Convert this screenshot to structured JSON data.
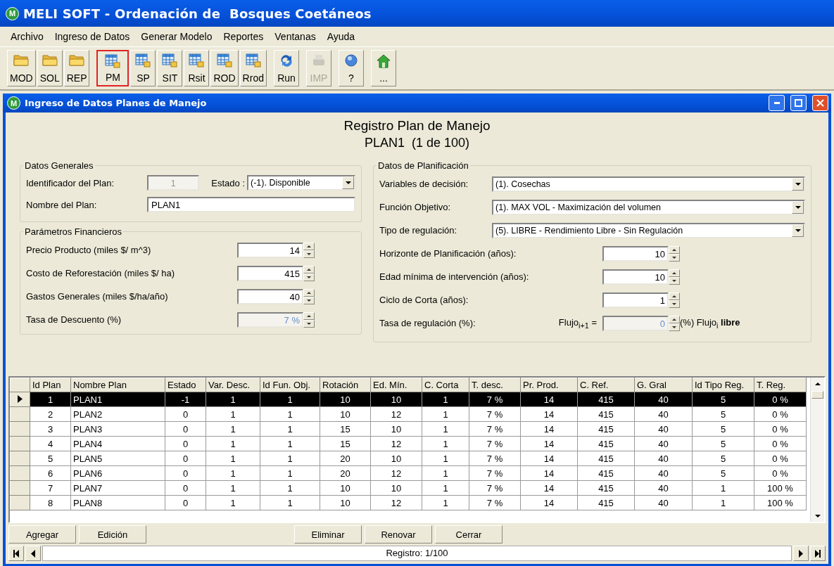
{
  "app": {
    "logo": "M",
    "title": "MELI SOFT - Ordenación de  Bosques Coetáneos"
  },
  "menu": [
    "Archivo",
    "Ingreso de Datos",
    "Generar Modelo",
    "Reportes",
    "Ventanas",
    "Ayuda"
  ],
  "toolbar": [
    [
      {
        "label": "MOD",
        "kind": "folder",
        "selected": false,
        "disabled": false
      },
      {
        "label": "SOL",
        "kind": "folder",
        "selected": false,
        "disabled": false
      },
      {
        "label": "REP",
        "kind": "folder",
        "selected": false,
        "disabled": false
      }
    ],
    [
      {
        "label": "PM",
        "kind": "table",
        "selected": true,
        "disabled": false
      },
      {
        "label": "SP",
        "kind": "table",
        "selected": false,
        "disabled": false
      },
      {
        "label": "SIT",
        "kind": "table",
        "selected": false,
        "disabled": false
      },
      {
        "label": "Rsit",
        "kind": "table",
        "selected": false,
        "disabled": false
      },
      {
        "label": "ROD",
        "kind": "table",
        "selected": false,
        "disabled": false
      },
      {
        "label": "Rrod",
        "kind": "table",
        "selected": false,
        "disabled": false
      }
    ],
    [
      {
        "label": "Run",
        "kind": "run",
        "selected": false,
        "disabled": false
      }
    ],
    [
      {
        "label": "IMP",
        "kind": "print",
        "selected": false,
        "disabled": true
      }
    ],
    [
      {
        "label": "?",
        "kind": "help",
        "selected": false,
        "disabled": false
      }
    ],
    [
      {
        "label": "...",
        "kind": "home",
        "selected": false,
        "disabled": false
      }
    ]
  ],
  "window": {
    "logo": "M",
    "title": "Ingreso de Datos Planes de Manejo",
    "heading": "Registro Plan de Manejo",
    "subheading": "PLAN1  (1 de 100)",
    "general": {
      "title": "Datos Generales",
      "id_label": "Identificador del Plan:",
      "id_value": "1",
      "estado_label": "Estado :",
      "estado_value": "(-1). Disponible",
      "name_label": "Nombre del Plan:",
      "name_value": "PLAN1"
    },
    "financial": {
      "title": "Parámetros Financieros",
      "fields": [
        {
          "label": "Precio Producto (miles $/ m^3)",
          "value": "14",
          "disabled": false
        },
        {
          "label": "Costo de Reforestación (miles $/ ha)",
          "value": "415",
          "disabled": false
        },
        {
          "label": "Gastos Generales (miles $/ha/año)",
          "value": "40",
          "disabled": false
        },
        {
          "label": "Tasa de Descuento (%)",
          "value": "7 %",
          "disabled": true
        }
      ]
    },
    "planning": {
      "title": "Datos de Planificación",
      "combos": [
        {
          "label": "Variables de decisión:",
          "value": "(1). Cosechas"
        },
        {
          "label": "Función Objetivo:",
          "value": "(1). MAX VOL - Maximización del volumen"
        },
        {
          "label": "Tipo de regulación:",
          "value": "(5). LIBRE - Rendimiento Libre - Sin Regulación"
        }
      ],
      "spins": [
        {
          "label": "Horizonte de Planificación (años):",
          "value": "10",
          "disabled": false
        },
        {
          "label": "Edad mínima de intervención (años):",
          "value": "10",
          "disabled": false
        },
        {
          "label": "Ciclo de Corta (años):",
          "value": "1",
          "disabled": false
        }
      ],
      "regulation": {
        "label": "Tasa de regulación (%):",
        "prefix": "Flujo$_{i+1}$ =",
        "value": "0",
        "disabled": true,
        "suffix": "(%) Flujo$_{i}$ **libre**"
      }
    },
    "grid": {
      "columns": [
        {
          "label": "Id Plan",
          "kind": "number"
        },
        {
          "label": "Nombre Plan",
          "kind": "text"
        },
        {
          "label": "Estado",
          "kind": "number"
        },
        {
          "label": "Var. Desc.",
          "kind": "number"
        },
        {
          "label": "Id Fun. Obj.",
          "kind": "number"
        },
        {
          "label": "Rotación",
          "kind": "number"
        },
        {
          "label": "Ed. Mín.",
          "kind": "number"
        },
        {
          "label": "C. Corta",
          "kind": "number"
        },
        {
          "label": "T. desc.",
          "kind": "number"
        },
        {
          "label": "Pr. Prod.",
          "kind": "number"
        },
        {
          "label": "C. Ref.",
          "kind": "number"
        },
        {
          "label": "G. Gral",
          "kind": "number"
        },
        {
          "label": "Id Tipo Reg.",
          "kind": "number"
        },
        {
          "label": "T. Reg.",
          "kind": "number"
        }
      ],
      "rows": [
        {
          "selected": true,
          "cells": [
            "1",
            "PLAN1",
            "-1",
            "1",
            "1",
            "10",
            "10",
            "1",
            "7 %",
            "14",
            "415",
            "40",
            "5",
            "0 %"
          ]
        },
        {
          "selected": false,
          "cells": [
            "2",
            "PLAN2",
            "0",
            "1",
            "1",
            "10",
            "12",
            "1",
            "7 %",
            "14",
            "415",
            "40",
            "5",
            "0 %"
          ]
        },
        {
          "selected": false,
          "cells": [
            "3",
            "PLAN3",
            "0",
            "1",
            "1",
            "15",
            "10",
            "1",
            "7 %",
            "14",
            "415",
            "40",
            "5",
            "0 %"
          ]
        },
        {
          "selected": false,
          "cells": [
            "4",
            "PLAN4",
            "0",
            "1",
            "1",
            "15",
            "12",
            "1",
            "7 %",
            "14",
            "415",
            "40",
            "5",
            "0 %"
          ]
        },
        {
          "selected": false,
          "cells": [
            "5",
            "PLAN5",
            "0",
            "1",
            "1",
            "20",
            "10",
            "1",
            "7 %",
            "14",
            "415",
            "40",
            "5",
            "0 %"
          ]
        },
        {
          "selected": false,
          "cells": [
            "6",
            "PLAN6",
            "0",
            "1",
            "1",
            "20",
            "12",
            "1",
            "7 %",
            "14",
            "415",
            "40",
            "5",
            "0 %"
          ]
        },
        {
          "selected": false,
          "cells": [
            "7",
            "PLAN7",
            "0",
            "1",
            "1",
            "10",
            "10",
            "1",
            "7 %",
            "14",
            "415",
            "40",
            "1",
            "100 %"
          ]
        },
        {
          "selected": false,
          "cells": [
            "8",
            "PLAN8",
            "0",
            "1",
            "1",
            "10",
            "12",
            "1",
            "7 %",
            "14",
            "415",
            "40",
            "1",
            "100 %"
          ]
        }
      ]
    },
    "buttons_left": [
      "Agregar",
      "Edición"
    ],
    "buttons_right": [
      "Eliminar",
      "Renovar",
      "Cerrar"
    ],
    "record": "Registro: 1/100"
  }
}
